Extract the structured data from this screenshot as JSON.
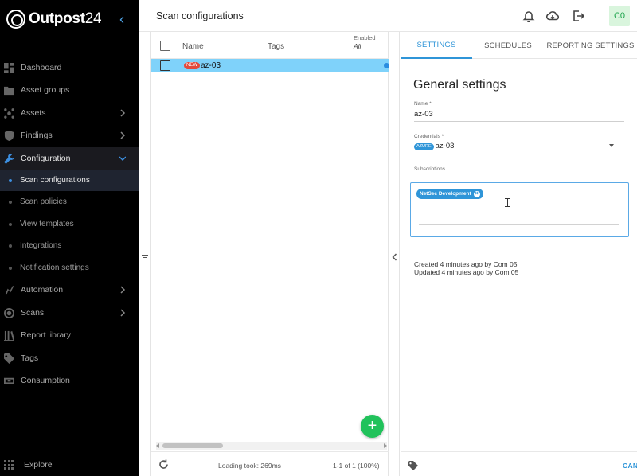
{
  "app": {
    "brand_bold": "Outpost",
    "brand_num": "24"
  },
  "sidebar": {
    "items": [
      {
        "label": "Dashboard",
        "icon": "dashboard-icon"
      },
      {
        "label": "Asset groups",
        "icon": "folder-icon"
      },
      {
        "label": "Assets",
        "icon": "assets-icon",
        "expandable": true
      },
      {
        "label": "Findings",
        "icon": "shield-icon",
        "expandable": true
      },
      {
        "label": "Configuration",
        "icon": "wrench-icon",
        "expandable": true,
        "expanded": true,
        "active": true
      },
      {
        "label": "Automation",
        "icon": "automation-icon",
        "expandable": true
      },
      {
        "label": "Scans",
        "icon": "radar-icon",
        "expandable": true
      },
      {
        "label": "Report library",
        "icon": "library-icon"
      },
      {
        "label": "Tags",
        "icon": "tag-icon"
      },
      {
        "label": "Consumption",
        "icon": "consumption-icon"
      }
    ],
    "sub_items": [
      {
        "label": "Scan configurations",
        "active": true
      },
      {
        "label": "Scan policies"
      },
      {
        "label": "View templates"
      },
      {
        "label": "Integrations"
      },
      {
        "label": "Notification settings"
      }
    ],
    "explore_label": "Explore"
  },
  "header": {
    "title": "Scan configurations",
    "avatar": "C0",
    "accent": "#1aa34a"
  },
  "table": {
    "columns": {
      "name": "Name",
      "tags": "Tags",
      "enabled": "Enabled",
      "enabled_filter": "All"
    },
    "rows": [
      {
        "badge": "NEW",
        "name": "az-03",
        "enabled": true
      }
    ],
    "footer": {
      "loading": "Loading took: 269ms",
      "pager": "1-1 of 1 (100%)"
    },
    "row_color": "#7fd2fa"
  },
  "detail": {
    "tabs": [
      {
        "label": "SETTINGS",
        "active": true
      },
      {
        "label": "SCHEDULES"
      },
      {
        "label": "REPORTING SETTINGS"
      }
    ],
    "section_title": "General settings",
    "name_label": "Name *",
    "name_value": "az-03",
    "credentials_label": "Credentials *",
    "credentials_badge": "AZURE",
    "credentials_value": "az-03",
    "subscriptions_label": "Subscriptions",
    "subscriptions": [
      "NetSec Development"
    ],
    "created": "Created 4 minutes ago by Com 05",
    "updated": "Updated 4 minutes ago by Com 05",
    "cancel_label": "CANCEL",
    "accent": "#2f95d8"
  }
}
